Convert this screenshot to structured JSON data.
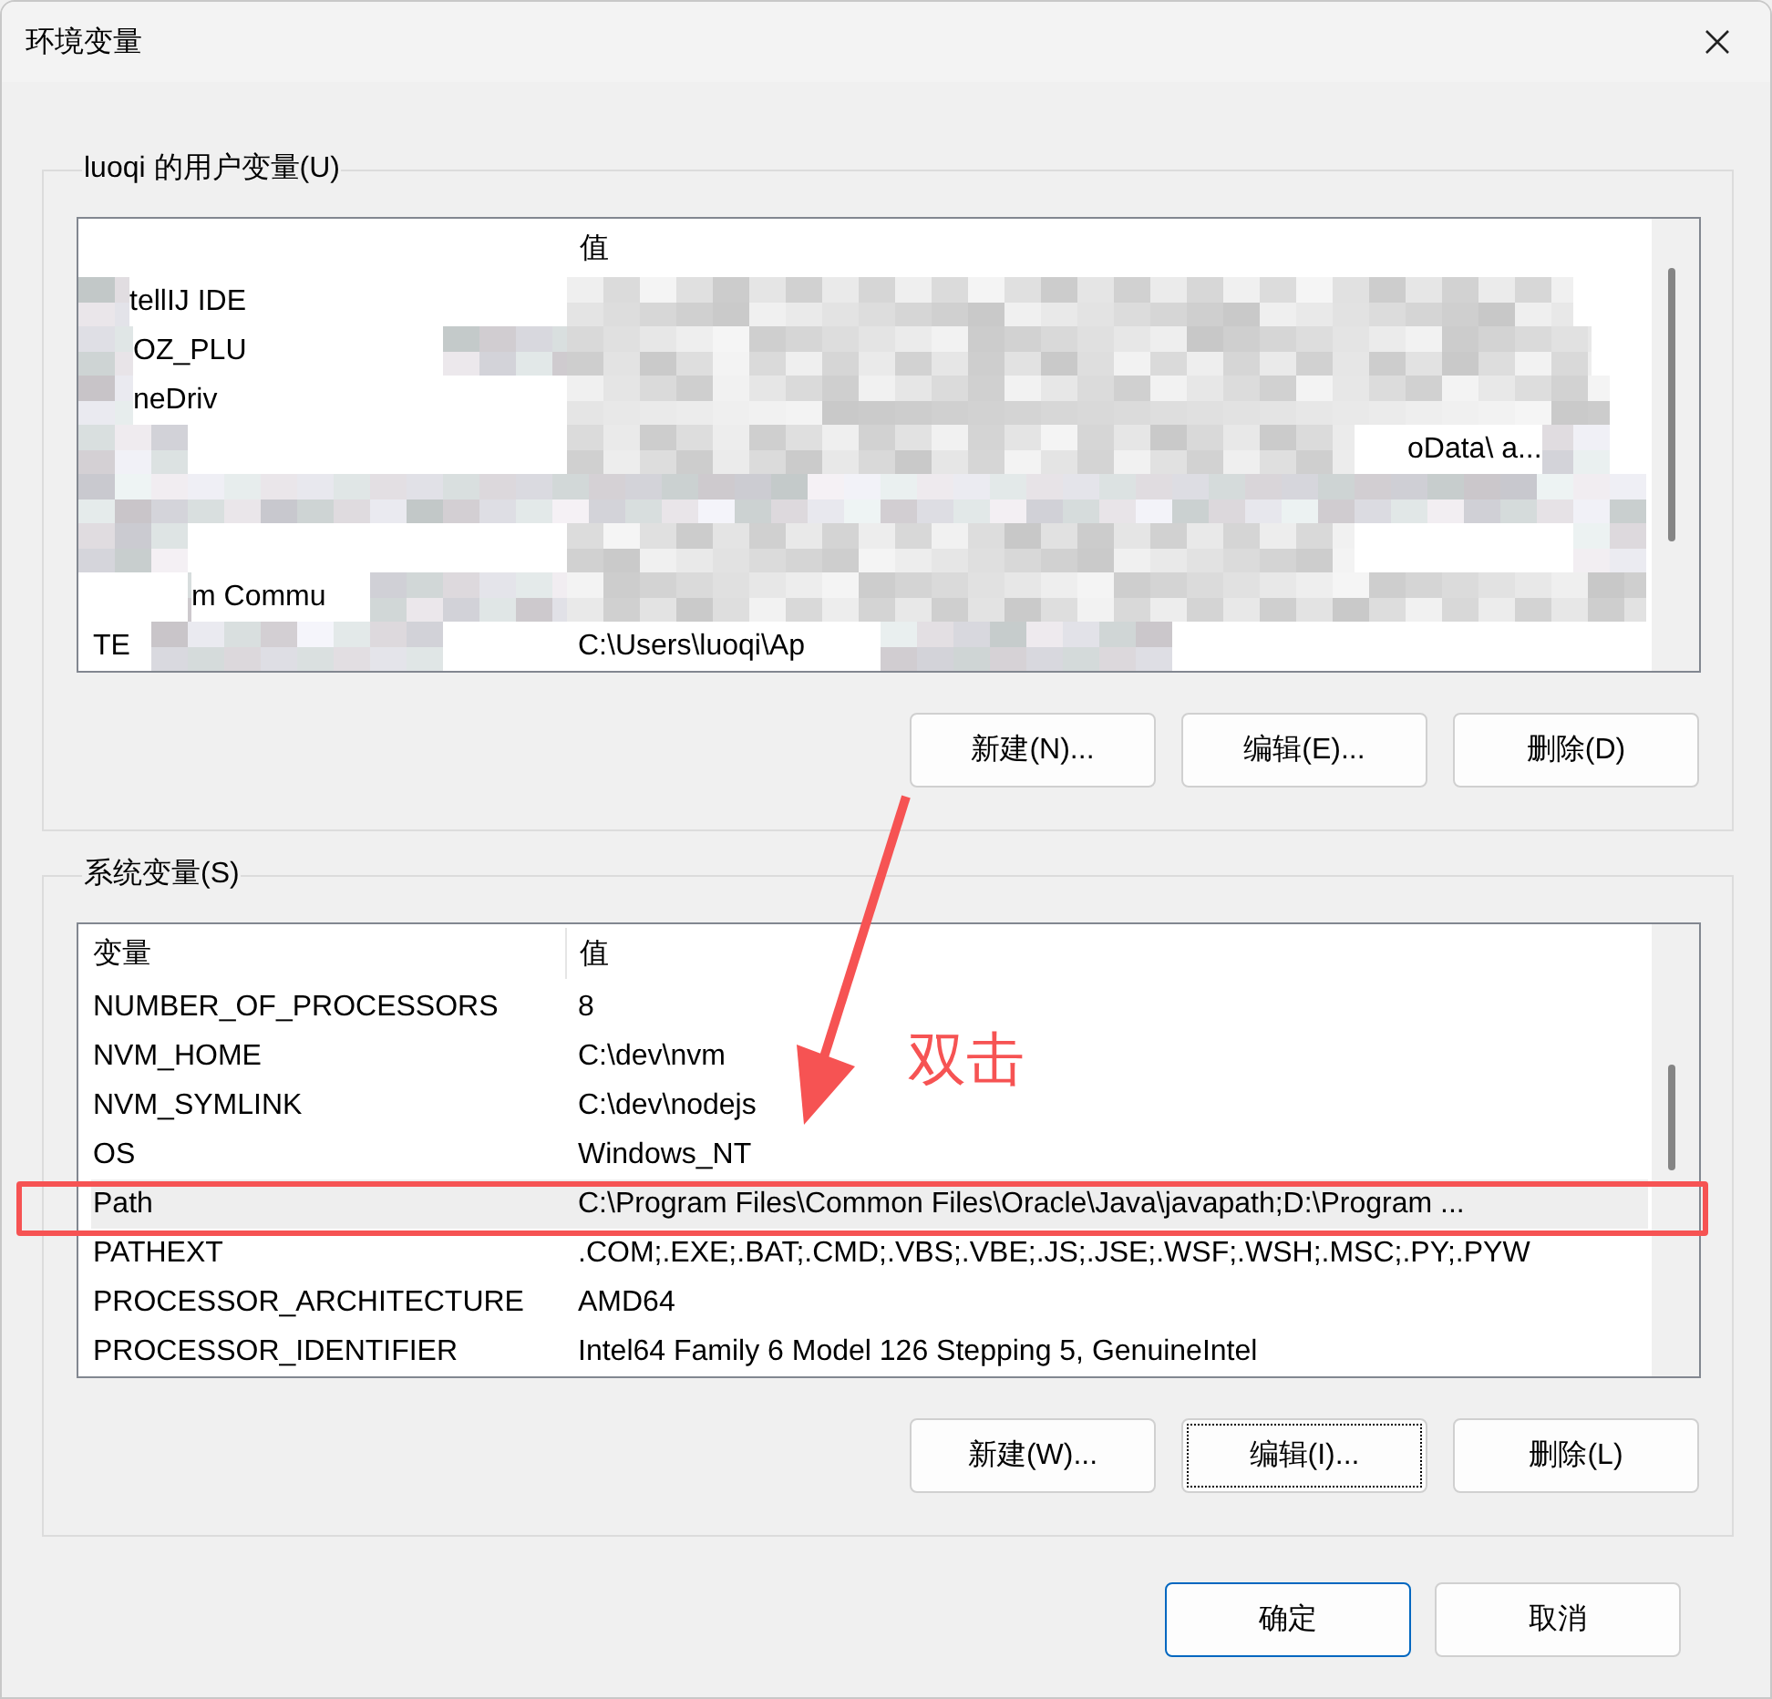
{
  "window": {
    "title": "环境变量"
  },
  "user_variables": {
    "label": "luoqi 的用户变量(U)",
    "header_value": "值",
    "rows": [
      {
        "name": "tellIJ IDE",
        "blurred": true
      },
      {
        "name": "OZ_PLU",
        "blurred": true
      },
      {
        "name": "neDriv",
        "blurred": true
      },
      {
        "value": "oData\\ a...",
        "blurred": true
      },
      {
        "blurred": true
      },
      {
        "blurred": true
      },
      {
        "name": "m Commu",
        "blurred": true
      },
      {
        "name": "TE",
        "value": "C:\\Users\\luoqi\\Ap",
        "blurred": true
      }
    ],
    "buttons": [
      {
        "label": "新建(N)...",
        "focused": false
      },
      {
        "label": "编辑(E)...",
        "focused": false
      },
      {
        "label": "删除(D)",
        "focused": false
      }
    ]
  },
  "system_variables": {
    "label": "系统变量(S)",
    "columns": [
      "变量",
      "值"
    ],
    "rows": [
      {
        "name": "NUMBER_OF_PROCESSORS",
        "value": "8",
        "selected": false
      },
      {
        "name": "NVM_HOME",
        "value": "C:\\dev\\nvm",
        "selected": false
      },
      {
        "name": "NVM_SYMLINK",
        "value": "C:\\dev\\nodejs",
        "selected": false
      },
      {
        "name": "OS",
        "value": "Windows_NT",
        "selected": false
      },
      {
        "name": "Path",
        "value": "C:\\Program Files\\Common Files\\Oracle\\Java\\javapath;D:\\Program ...",
        "selected": true
      },
      {
        "name": "PATHEXT",
        "value": ".COM;.EXE;.BAT;.CMD;.VBS;.VBE;.JS;.JSE;.WSF;.WSH;.MSC;.PY;.PYW",
        "selected": false
      },
      {
        "name": "PROCESSOR_ARCHITECTURE",
        "value": "AMD64",
        "selected": false
      },
      {
        "name": "PROCESSOR_IDENTIFIER",
        "value": "Intel64 Family 6 Model 126 Stepping 5, GenuineIntel",
        "selected": false
      }
    ],
    "buttons": [
      {
        "label": "新建(W)...",
        "focused": false
      },
      {
        "label": "编辑(I)...",
        "focused": true
      },
      {
        "label": "删除(L)",
        "focused": false
      }
    ]
  },
  "footer_buttons": [
    {
      "label": "确定",
      "default": true
    },
    {
      "label": "取消",
      "default": false
    }
  ],
  "annotation": {
    "text": "双击"
  }
}
